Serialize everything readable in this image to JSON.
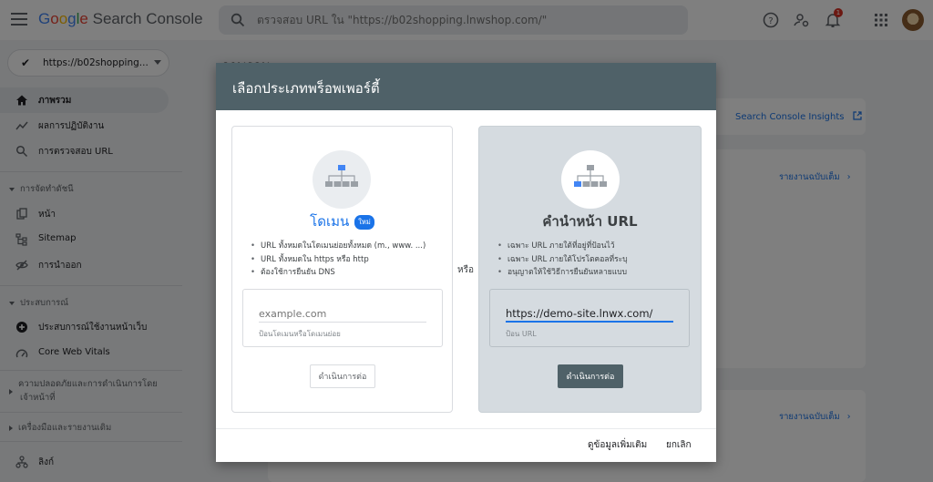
{
  "header": {
    "brand_google": [
      "G",
      "o",
      "o",
      "g",
      "l",
      "e"
    ],
    "brand_rest": "Search Console",
    "search_placeholder": "ตรวจสอบ URL ใน \"https://b02shopping.lnwshop.com/\"",
    "notification_count": "1",
    "icons": [
      "menu-icon",
      "search-icon",
      "help-icon",
      "user-settings-icon",
      "bell-icon",
      "apps-grid-icon"
    ]
  },
  "sidebar": {
    "property": "https://b02shopping...",
    "items": [
      {
        "label": "ภาพรวม",
        "icon": "home-icon",
        "active": true
      },
      {
        "label": "ผลการปฏิบัติงาน",
        "icon": "trend-icon"
      },
      {
        "label": "การตรวจสอบ URL",
        "icon": "search-icon"
      }
    ],
    "section_index": "การจัดทำดัชนี",
    "index_items": [
      {
        "label": "หน้า",
        "icon": "pages-icon"
      },
      {
        "label": "Sitemap",
        "icon": "sitemap-icon"
      },
      {
        "label": "การนำออก",
        "icon": "eye-off-icon"
      }
    ],
    "section_experience": "ประสบการณ์",
    "experience_items": [
      {
        "label": "ประสบการณ์ใช้งานหน้าเว็บ",
        "icon": "plus-circle-icon"
      },
      {
        "label": "Core Web Vitals",
        "icon": "gauge-icon"
      }
    ],
    "section_security_line1": "ความปลอดภัยและการดำเนินการโดย",
    "section_security_line2": "เจ้าหน้าที่",
    "section_tools": "เครื่องมือและรายงานเดิม",
    "links_item": {
      "label": "ลิงก์",
      "icon": "links-icon"
    }
  },
  "main": {
    "page_title": "ภาพรวม",
    "insights_link": "Search Console Insights",
    "full_report_1": "รายงานฉบับเต็ม",
    "full_report_2": "รายงานฉบับเต็ม"
  },
  "dialog": {
    "title": "เลือกประเภทพร็อพเพอร์ตี้",
    "or_label": "หรือ",
    "domain": {
      "title": "โดเมน",
      "badge": "ใหม่",
      "bullets": [
        "URL ทั้งหมดในโดเมนย่อยทั้งหมด (m., www. ...)",
        "URL ทั้งหมดใน https หรือ http",
        "ต้องใช้การยืนยัน DNS"
      ],
      "input_placeholder": "example.com",
      "hint": "ป้อนโดเมนหรือโดเมนย่อย",
      "button": "ดำเนินการต่อ"
    },
    "url_prefix": {
      "title": "คำนำหน้า URL",
      "bullets": [
        "เฉพาะ URL ภายใต้ที่อยู่ที่ป้อนไว้",
        "เฉพาะ URL ภายใต้โปรโตคอลที่ระบุ",
        "อนุญาตให้ใช้วิธีการยืนยันหลายแบบ"
      ],
      "input_value": "https://demo-site.lnwx.com/",
      "hint": "ป้อน URL",
      "button": "ดำเนินการต่อ"
    },
    "learn_more": "ดูข้อมูลเพิ่มเติม",
    "cancel": "ยกเลิก"
  },
  "colors": {
    "accent": "#1a73e8",
    "dialog_header": "#4f6168",
    "selected_panel": "#d5dbe0"
  }
}
